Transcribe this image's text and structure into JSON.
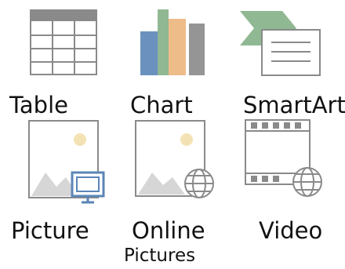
{
  "placeholders": [
    {
      "label": "Table",
      "icon": "table-icon"
    },
    {
      "label": "Chart",
      "icon": "chart-icon"
    },
    {
      "label": "SmartArt",
      "icon": "smartart-icon"
    },
    {
      "label": "Picture",
      "icon": "picture-icon"
    },
    {
      "label": "Online",
      "label_line2": "Pictures",
      "icon": "online-pictures-icon"
    },
    {
      "label": "Video",
      "icon": "video-icon"
    }
  ],
  "colors": {
    "gray": "#8a8a8a",
    "light_gray": "#d6d6d6",
    "blue": "#5b86b7",
    "orange": "#ecb57c",
    "green": "#84b087",
    "sun": "#f3e2b4"
  }
}
